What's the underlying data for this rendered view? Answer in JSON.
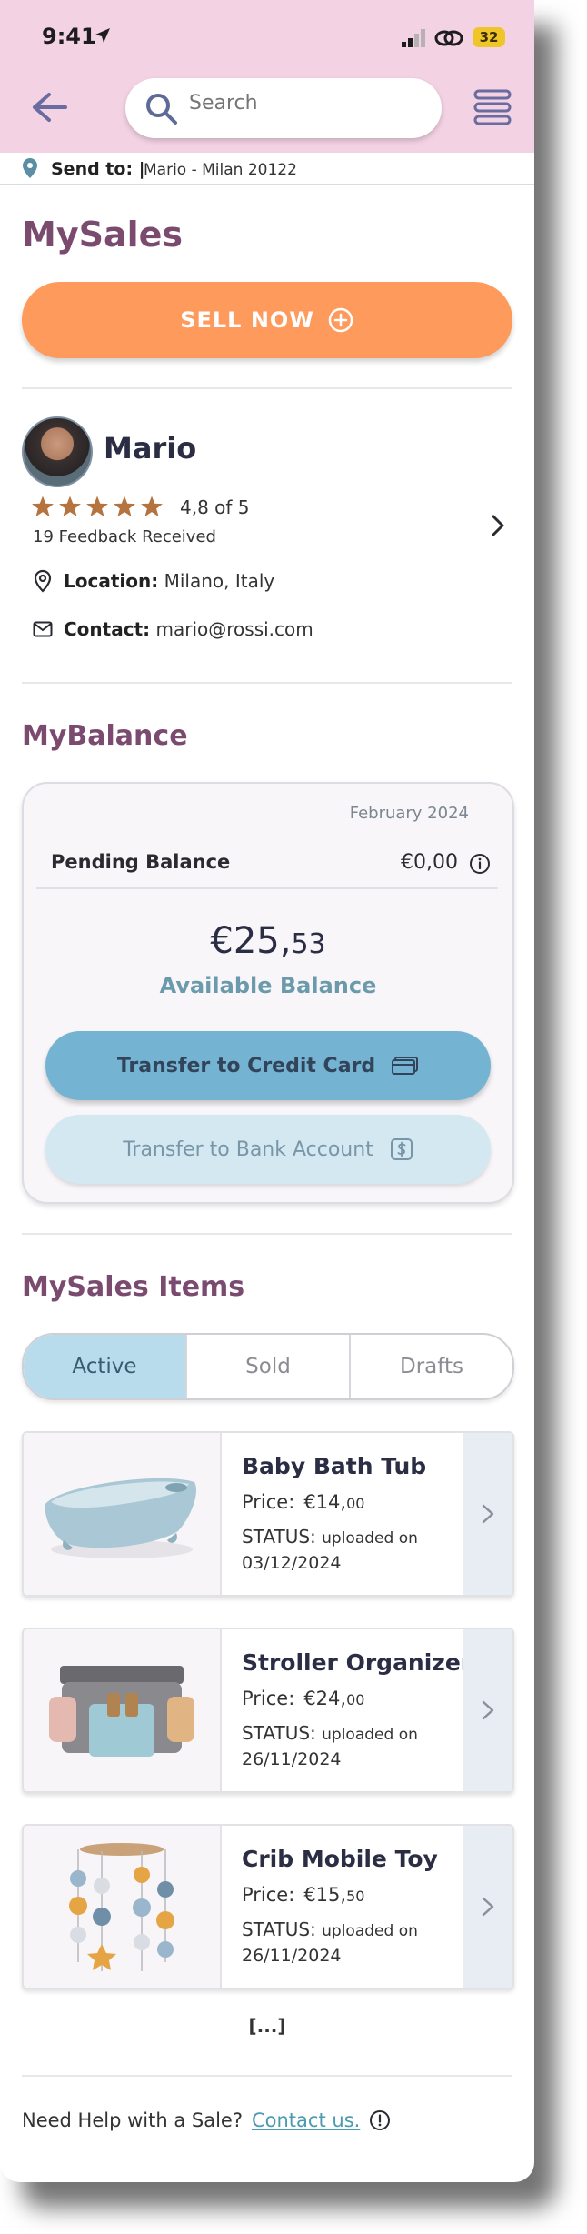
{
  "status_bar": {
    "time": "9:41",
    "battery": "32"
  },
  "search": {
    "placeholder": "Search"
  },
  "send_to": {
    "label": "Send to: |",
    "address": "Mario - Milan 20122"
  },
  "page_title": "MySales",
  "sell_button": {
    "label": "SELL NOW"
  },
  "profile": {
    "name": "Mario",
    "stars": 5,
    "rating": "4,8 of 5",
    "feedback": "19 Feedback Received",
    "location_label": "Location:",
    "location_value": "Milano, Italy",
    "contact_label": "Contact:",
    "contact_value": "mario@rossi.com"
  },
  "balance": {
    "section_title": "MyBalance",
    "date": "February 2024",
    "pending_label": "Pending Balance",
    "pending_value": "€0,00",
    "available_main": "€25,",
    "available_cents": "53",
    "available_label": "Available Balance",
    "transfer_card": "Transfer to Credit Card",
    "transfer_bank": "Transfer to Bank Account"
  },
  "items_section": {
    "title": "MySales Items",
    "tabs": [
      "Active",
      "Sold",
      "Drafts"
    ],
    "selected_tab": "Active",
    "items": [
      {
        "title": "Baby Bath Tub",
        "price_label": "Price:",
        "price_main": "€14,",
        "price_cents": "00",
        "status_label": "STATUS:",
        "status_text": "uploaded on",
        "date": "03/12/2024"
      },
      {
        "title": "Stroller Organizer",
        "price_label": "Price:",
        "price_main": "€24,",
        "price_cents": "00",
        "status_label": "STATUS:",
        "status_text": "uploaded on",
        "date": "26/11/2024"
      },
      {
        "title": "Crib Mobile Toy",
        "price_label": "Price:",
        "price_main": "€15,",
        "price_cents": "50",
        "status_label": "STATUS:",
        "status_text": "uploaded on",
        "date": "26/11/2024"
      }
    ],
    "more": "[...]"
  },
  "help": {
    "text": "Need Help with a Sale?",
    "link": "Contact us."
  },
  "colors": {
    "header": "#f3d2e3",
    "sell": "#fe9a5b",
    "title": "#7b4a6f",
    "primary_button": "#74b3d1",
    "star": "#b5733f"
  }
}
